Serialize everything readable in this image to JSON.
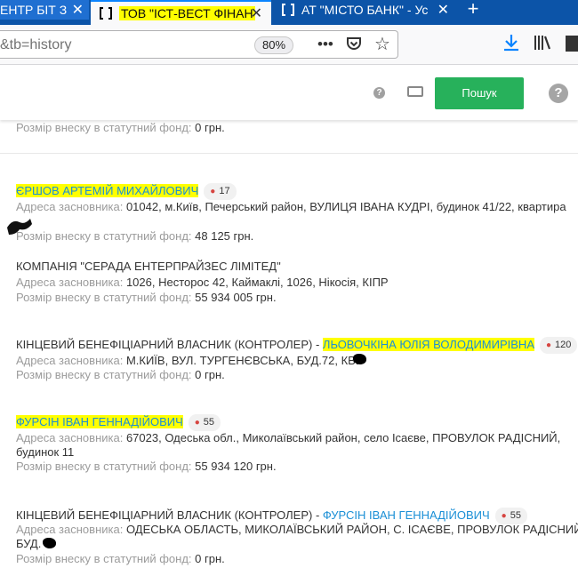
{
  "tabs": [
    {
      "label_pre": "ЕНТР БІТ З",
      "label_fade": "",
      "close": "✕"
    },
    {
      "label": "ТОВ \"ІСТ-ВЕСТ ФІНАН",
      "close": "✕"
    },
    {
      "label": "АТ \"МІСТО БАНК\" - Ус",
      "close": "✕"
    }
  ],
  "newtab": "+",
  "url": "&tb=history",
  "zoom": "80%",
  "search": {
    "button": "Пошук",
    "help": "?",
    "kbd_help": "?"
  },
  "colors": {
    "accent": "#27b15b",
    "tabbar": "#0c54a8",
    "link": "#1a8fd6",
    "highlight": "#ffff00"
  },
  "records": {
    "top": {
      "label": "Розмір внеску в статутний фонд:",
      "value": "0 грн."
    },
    "r1": {
      "name": "ЄРШОВ АРТЕМІЙ МИХАЙЛОВИЧ",
      "badge": "17",
      "addr_label": "Адреса засновника:",
      "addr": "01042, м.Київ, Печерський район, ВУЛИЦЯ ІВАНА КУДРІ, будинок 41/22, квартира",
      "fund_label": "Розмір внеску в статутний фонд:",
      "fund": "48 125 грн."
    },
    "r2": {
      "name": "КОМПАНІЯ \"СЕРАДА ЕНТЕРПРАЙЗЕС ЛІМІТЕД\"",
      "addr_label": "Адреса засновника:",
      "addr": "1026, Несторос 42, Каймаклі, 1026, Нікосія, КІПР",
      "fund_label": "Розмір внеску в статутний фонд:",
      "fund": "55 934 005 грн."
    },
    "r3": {
      "prefix": "КІНЦЕВИЙ БЕНЕФІЦІАРНИЙ ВЛАСНИК (КОНТРОЛЕР) -",
      "name": "ЛЬОВОЧКІНА ЮЛІЯ ВОЛОДИМИРІВНА",
      "badge": "120",
      "addr_label": "Адреса засновника:",
      "addr": "М.КИЇВ, ВУЛ. ТУРГЕНЄВСЬКА, БУД.72, КВ.",
      "fund_label": "Розмір внеску в статутний фонд:",
      "fund": "0 грн."
    },
    "r4": {
      "name": "ФУРСІН ІВАН ГЕННАДІЙОВИЧ",
      "badge": "55",
      "addr_label": "Адреса засновника:",
      "addr": "67023, Одеська обл., Миколаївський район, село Ісаєве, ПРОВУЛОК РАДІСНИЙ,",
      "addr2": "будинок 11",
      "fund_label": "Розмір внеску в статутний фонд:",
      "fund": "55 934 120 грн."
    },
    "r5": {
      "prefix": "КІНЦЕВИЙ БЕНЕФІЦІАРНИЙ ВЛАСНИК (КОНТРОЛЕР) -",
      "name": "ФУРСІН ІВАН ГЕННАДІЙОВИЧ",
      "badge": "55",
      "addr_label": "Адреса засновника:",
      "addr": "ОДЕСЬКА ОБЛАСТЬ, МИКОЛАЇВСЬКИЙ РАЙОН, С. ІСАЄВЕ, ПРОВУЛОК РАДІСНИЙ,",
      "addr2": "БУД.",
      "fund_label": "Розмір внеску в статутний фонд:",
      "fund": "0 грн."
    }
  }
}
